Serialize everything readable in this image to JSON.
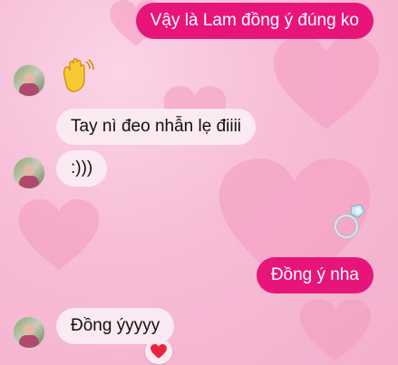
{
  "conversation": {
    "messages": [
      {
        "sender": "me",
        "text": "Vậy là Lam đồng ý đúng ko"
      },
      {
        "sender": "other",
        "emoji": "waving-hand"
      },
      {
        "sender": "other",
        "text": "Tay nì đeo nhẫn lẹ điiii"
      },
      {
        "sender": "other",
        "text": ":)))"
      },
      {
        "sender": "me",
        "emoji": "ring"
      },
      {
        "sender": "me",
        "text": "Đồng ý nha"
      },
      {
        "sender": "other",
        "text": "Đồng ýyyyy",
        "reaction": "❤️"
      }
    ]
  },
  "theme": {
    "outgoing_bubble": "#e7157a",
    "incoming_bubble": "#fbeaf1",
    "background": "#f7bcd6"
  }
}
